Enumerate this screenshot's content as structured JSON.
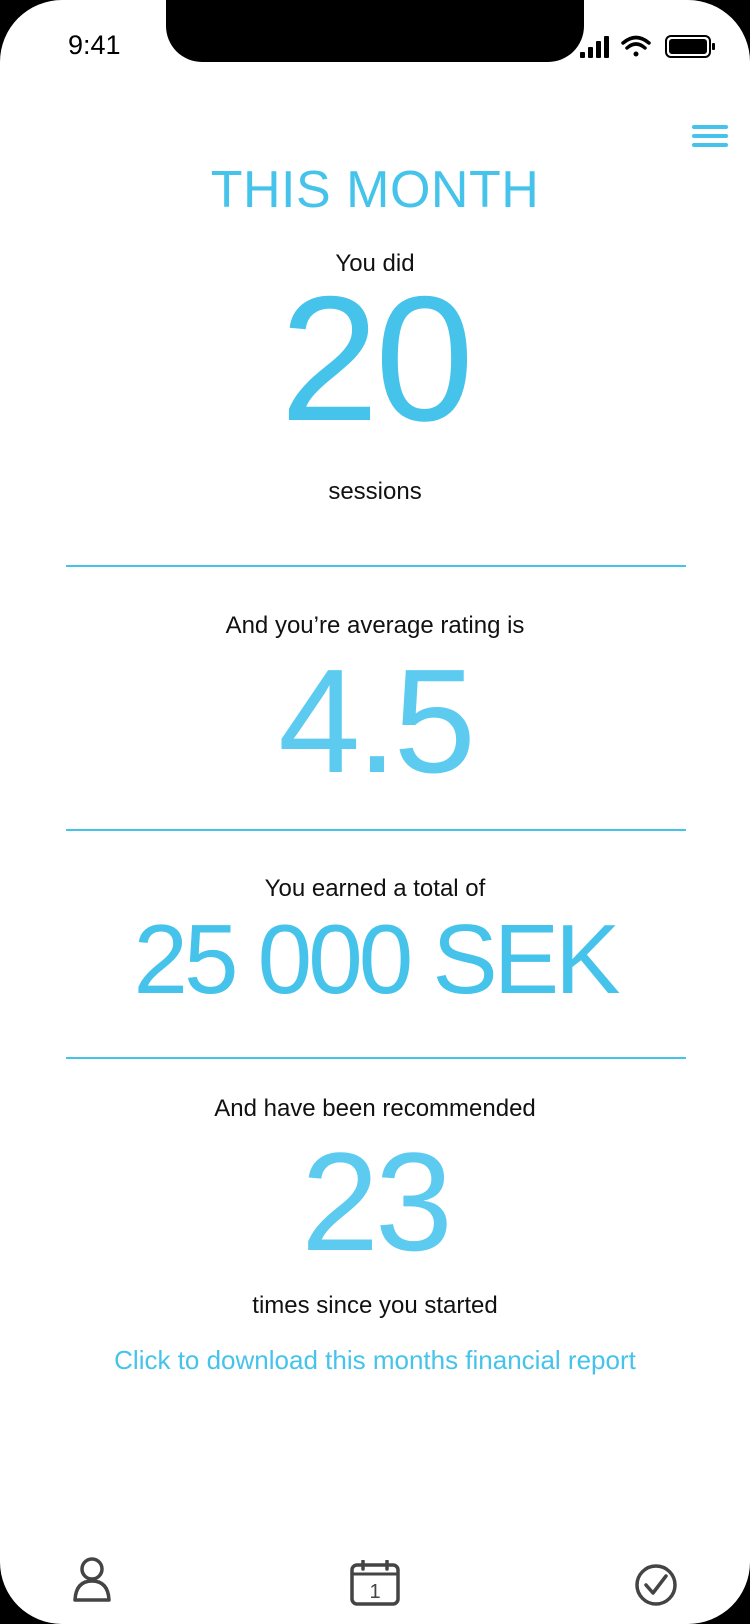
{
  "status_bar": {
    "time": "9:41"
  },
  "header": {
    "title": "THIS MONTH"
  },
  "sessions": {
    "intro": "You did",
    "value": "20",
    "suffix": "sessions"
  },
  "rating": {
    "intro": "And you’re average rating is",
    "value": "4.5"
  },
  "earnings": {
    "intro": "You earned a total of",
    "value": "25 000 SEK"
  },
  "recommendations": {
    "intro": "And have been recommended",
    "value": "23",
    "suffix": "times since you started"
  },
  "report_link": {
    "label": "Click to download this months financial report"
  },
  "tab_bar": {
    "items": [
      {
        "icon": "person-icon"
      },
      {
        "icon": "calendar-icon",
        "badge": "1"
      },
      {
        "icon": "checkmark-circle-icon"
      }
    ]
  },
  "colors": {
    "accent": "#45C3EA",
    "text": "#111111",
    "icon": "#444444"
  }
}
